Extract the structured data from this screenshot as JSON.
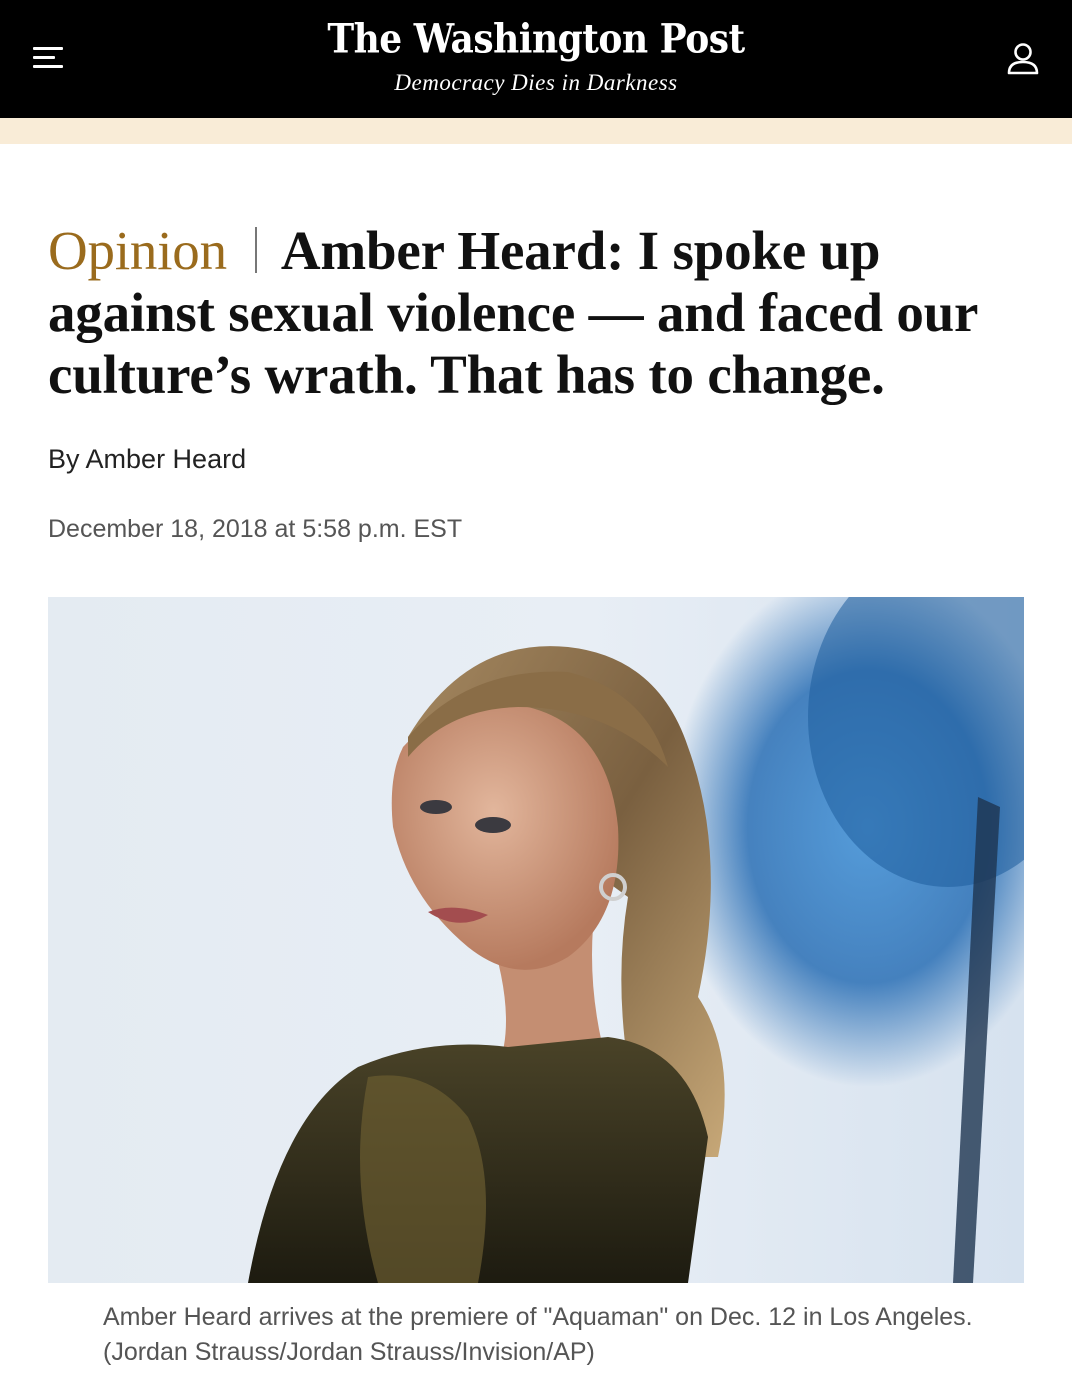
{
  "header": {
    "logo": "The Washington Post",
    "tagline": "Democracy Dies in Darkness"
  },
  "article": {
    "kicker": "Opinion",
    "headline": "Amber Heard: I spoke up against sexual violence — and faced our culture’s wrath. That has to change.",
    "byline_prefix": "By",
    "author": "Amber Heard",
    "timestamp": "December 18, 2018 at 5:58 p.m. EST",
    "photo": {
      "caption": "Amber Heard arrives at the premiere of \"Aquaman\" on Dec. 12 in Los Angeles. (Jordan Strauss/Jordan Strauss/Invision/AP)"
    }
  },
  "colors": {
    "topbar": "#000000",
    "promo_band": "#f9ecd7",
    "kicker": "#9a6b1d"
  },
  "icons": [
    "menu-icon",
    "user-icon"
  ]
}
